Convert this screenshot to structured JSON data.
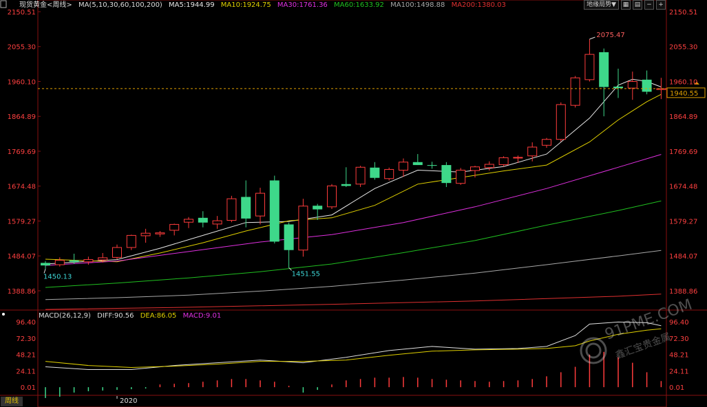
{
  "legend": {
    "symbol": "现货黄金<周线>",
    "ma_params": "MA(5,10,30,60,100,200)",
    "ma5": "MA5:1944.99",
    "ma10": "MA10:1924.75",
    "ma30": "MA30:1761.36",
    "ma60": "MA60:1633.92",
    "ma100": "MA100:1498.88",
    "ma200": "MA200:1380.03"
  },
  "macd_legend": {
    "params": "MACD(26,12,9)",
    "diff": "DIFF:90.56",
    "dea": "DEA:86.05",
    "macd": "MACD:9.01"
  },
  "toolbar": {
    "overlay_label": "地缘局势▼",
    "icons": [
      "grid-icon",
      "layout-icon",
      "minus-icon",
      "plus-icon"
    ]
  },
  "period_tab": "周线",
  "watermark": {
    "line1": "91PME.COM",
    "line2": "鑫汇宝贵金属"
  },
  "colors": {
    "up": "#ff3c3c",
    "down": "#3ed88a",
    "ma5": "#e8e8e8",
    "ma10": "#e0d000",
    "ma30": "#e030e0",
    "ma60": "#20c020",
    "ma100": "#a8a8a8",
    "ma200": "#e03030",
    "axis_text": "#ff4040",
    "current": "#e0a000"
  },
  "chart_data": {
    "type": "candlestick",
    "price_axis_ticks": [
      "2150.51",
      "2055.30",
      "1960.10",
      "1864.89",
      "1769.69",
      "1674.48",
      "1579.27",
      "1484.07",
      "1388.86"
    ],
    "ylim": [
      1340,
      2150.51
    ],
    "x_label": "2020",
    "current_price": "1940.55",
    "annotations": {
      "high": "2075.47",
      "low1": "1450.13",
      "low2": "1451.55"
    },
    "candles": [
      {
        "o": 1465,
        "h": 1470,
        "l": 1448,
        "c": 1458
      },
      {
        "o": 1460,
        "h": 1480,
        "l": 1455,
        "c": 1472
      },
      {
        "o": 1472,
        "h": 1490,
        "l": 1462,
        "c": 1468
      },
      {
        "o": 1468,
        "h": 1482,
        "l": 1460,
        "c": 1474
      },
      {
        "o": 1473,
        "h": 1492,
        "l": 1466,
        "c": 1479
      },
      {
        "o": 1480,
        "h": 1515,
        "l": 1475,
        "c": 1507
      },
      {
        "o": 1507,
        "h": 1542,
        "l": 1500,
        "c": 1540
      },
      {
        "o": 1539,
        "h": 1558,
        "l": 1520,
        "c": 1546
      },
      {
        "o": 1544,
        "h": 1552,
        "l": 1536,
        "c": 1547
      },
      {
        "o": 1554,
        "h": 1572,
        "l": 1540,
        "c": 1570
      },
      {
        "o": 1576,
        "h": 1590,
        "l": 1560,
        "c": 1584
      },
      {
        "o": 1588,
        "h": 1606,
        "l": 1562,
        "c": 1575
      },
      {
        "o": 1571,
        "h": 1593,
        "l": 1558,
        "c": 1580
      },
      {
        "o": 1581,
        "h": 1648,
        "l": 1576,
        "c": 1640
      },
      {
        "o": 1645,
        "h": 1690,
        "l": 1562,
        "c": 1586
      },
      {
        "o": 1593,
        "h": 1670,
        "l": 1570,
        "c": 1655
      },
      {
        "o": 1690,
        "h": 1703,
        "l": 1518,
        "c": 1523
      },
      {
        "o": 1570,
        "h": 1575,
        "l": 1452,
        "c": 1500
      },
      {
        "o": 1500,
        "h": 1640,
        "l": 1482,
        "c": 1620
      },
      {
        "o": 1621,
        "h": 1626,
        "l": 1582,
        "c": 1611
      },
      {
        "o": 1618,
        "h": 1680,
        "l": 1612,
        "c": 1675
      },
      {
        "o": 1680,
        "h": 1726,
        "l": 1672,
        "c": 1675
      },
      {
        "o": 1680,
        "h": 1730,
        "l": 1672,
        "c": 1726
      },
      {
        "o": 1725,
        "h": 1740,
        "l": 1692,
        "c": 1697
      },
      {
        "o": 1695,
        "h": 1725,
        "l": 1690,
        "c": 1720
      },
      {
        "o": 1718,
        "h": 1750,
        "l": 1700,
        "c": 1740
      },
      {
        "o": 1740,
        "h": 1762,
        "l": 1732,
        "c": 1732
      },
      {
        "o": 1732,
        "h": 1741,
        "l": 1722,
        "c": 1730
      },
      {
        "o": 1732,
        "h": 1740,
        "l": 1672,
        "c": 1683
      },
      {
        "o": 1682,
        "h": 1724,
        "l": 1678,
        "c": 1718
      },
      {
        "o": 1717,
        "h": 1730,
        "l": 1698,
        "c": 1727
      },
      {
        "o": 1725,
        "h": 1742,
        "l": 1717,
        "c": 1734
      },
      {
        "o": 1733,
        "h": 1756,
        "l": 1728,
        "c": 1752
      },
      {
        "o": 1751,
        "h": 1758,
        "l": 1738,
        "c": 1753
      },
      {
        "o": 1757,
        "h": 1794,
        "l": 1742,
        "c": 1781
      },
      {
        "o": 1786,
        "h": 1806,
        "l": 1779,
        "c": 1802
      },
      {
        "o": 1802,
        "h": 1903,
        "l": 1796,
        "c": 1897
      },
      {
        "o": 1895,
        "h": 1975,
        "l": 1889,
        "c": 1970
      },
      {
        "o": 1965,
        "h": 2075.47,
        "l": 1960,
        "c": 2034
      },
      {
        "o": 2040,
        "h": 2050,
        "l": 1865,
        "c": 1945
      },
      {
        "o": 1946,
        "h": 1995,
        "l": 1915,
        "c": 1942
      },
      {
        "o": 1942,
        "h": 1987,
        "l": 1910,
        "c": 1960
      },
      {
        "o": 1965,
        "h": 1990,
        "l": 1925,
        "c": 1932
      },
      {
        "o": 1938,
        "h": 1970,
        "l": 1912,
        "c": 1940.55
      }
    ],
    "ma_series": [
      {
        "name": "MA5",
        "x": [
          0,
          5,
          8,
          11,
          14,
          17,
          20,
          23,
          26,
          29,
          32,
          35,
          38,
          40,
          41,
          42,
          43
        ],
        "y": [
          1462,
          1474,
          1505,
          1540,
          1575,
          1578,
          1596,
          1668,
          1718,
          1713,
          1728,
          1762,
          1860,
          1950,
          1966,
          1960,
          1945
        ]
      },
      {
        "name": "MA10",
        "x": [
          0,
          5,
          8,
          11,
          14,
          17,
          20,
          23,
          26,
          29,
          32,
          35,
          38,
          40,
          41,
          42,
          43
        ],
        "y": [
          1475,
          1468,
          1492,
          1520,
          1552,
          1580,
          1588,
          1622,
          1680,
          1698,
          1716,
          1732,
          1795,
          1855,
          1880,
          1905,
          1925
        ]
      },
      {
        "name": "MA30",
        "x": [
          0,
          5,
          10,
          15,
          20,
          25,
          30,
          35,
          40,
          43
        ],
        "y": [
          1458,
          1470,
          1496,
          1522,
          1542,
          1575,
          1618,
          1668,
          1726,
          1761
        ]
      },
      {
        "name": "MA60",
        "x": [
          0,
          5,
          10,
          15,
          20,
          25,
          30,
          35,
          40,
          43
        ],
        "y": [
          1398,
          1410,
          1424,
          1441,
          1462,
          1493,
          1526,
          1568,
          1608,
          1634
        ]
      },
      {
        "name": "MA100",
        "x": [
          0,
          5,
          10,
          15,
          20,
          25,
          30,
          35,
          40,
          43
        ],
        "y": [
          1365,
          1370,
          1377,
          1388,
          1401,
          1418,
          1437,
          1460,
          1484,
          1499
        ]
      },
      {
        "name": "MA200",
        "x": [
          0,
          10,
          20,
          30,
          40,
          43
        ],
        "y": [
          1338,
          1344,
          1352,
          1361,
          1374,
          1380
        ]
      }
    ],
    "macd": {
      "axis_ticks": [
        "96.40",
        "72.30",
        "48.21",
        "24.11",
        "0.01"
      ],
      "ylim": [
        -12,
        96.4
      ],
      "diff": {
        "x": [
          0,
          3,
          6,
          9,
          12,
          15,
          18,
          21,
          24,
          27,
          30,
          33,
          35,
          37,
          38,
          40,
          42,
          43
        ],
        "y": [
          30,
          26,
          26,
          32,
          36,
          40,
          36,
          44,
          54,
          60,
          56,
          57,
          60,
          76,
          93,
          96,
          95,
          90.56
        ]
      },
      "dea": {
        "x": [
          0,
          3,
          6,
          9,
          12,
          15,
          18,
          21,
          24,
          27,
          30,
          33,
          35,
          37,
          38,
          40,
          42,
          43
        ],
        "y": [
          38,
          32,
          29,
          31,
          34,
          38,
          38,
          40,
          47,
          53,
          55,
          56,
          57,
          61,
          68,
          78,
          84,
          86.05
        ]
      },
      "histogram": [
        -16,
        -14,
        -8,
        -6,
        -5,
        -4,
        -3,
        -2,
        4,
        5,
        6,
        8,
        10,
        12,
        12,
        10,
        8,
        2,
        -8,
        -4,
        4,
        10,
        12,
        14,
        14,
        15,
        14,
        12,
        11,
        10,
        9,
        8,
        9,
        10,
        12,
        16,
        22,
        30,
        48,
        52,
        44,
        36,
        22,
        9.01
      ]
    }
  }
}
